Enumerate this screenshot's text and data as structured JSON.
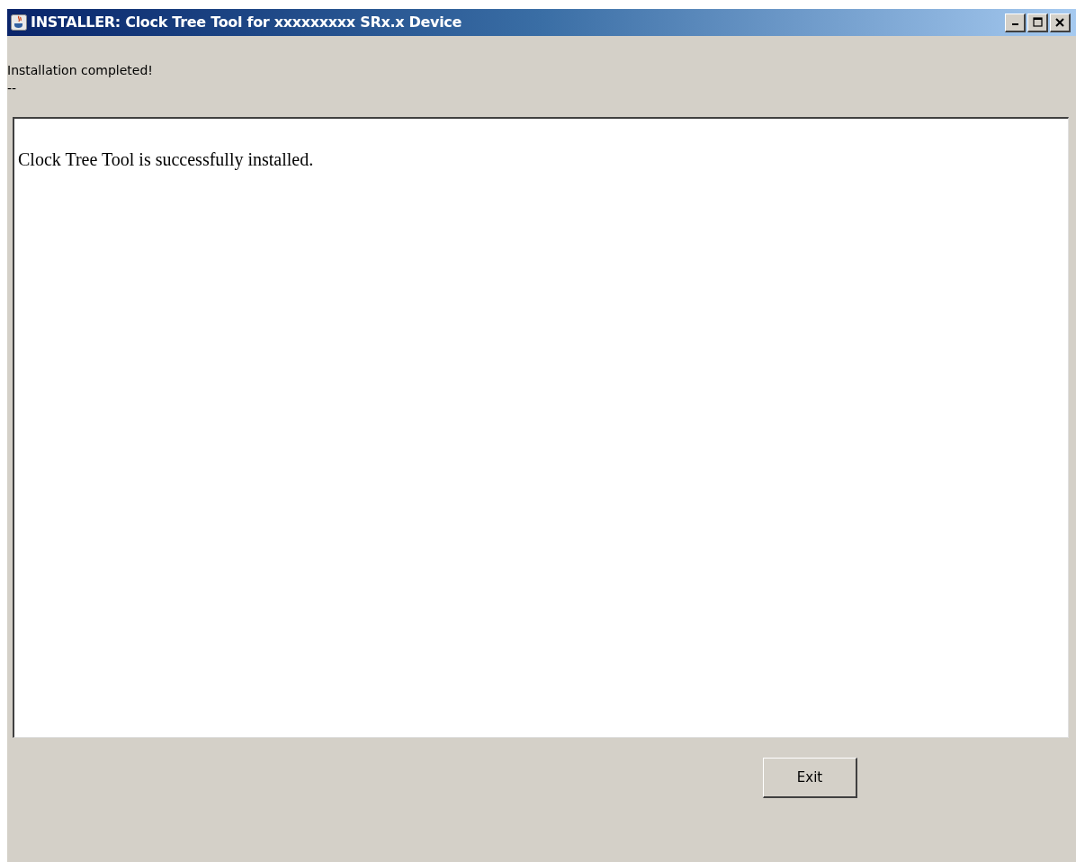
{
  "window": {
    "title": "INSTALLER: Clock Tree Tool for xxxxxxxxx SRx.x Device"
  },
  "status": {
    "heading": "Installation completed!",
    "detail": "--"
  },
  "message": {
    "text": "Clock Tree Tool is successfully installed."
  },
  "buttons": [
    "Exit"
  ]
}
